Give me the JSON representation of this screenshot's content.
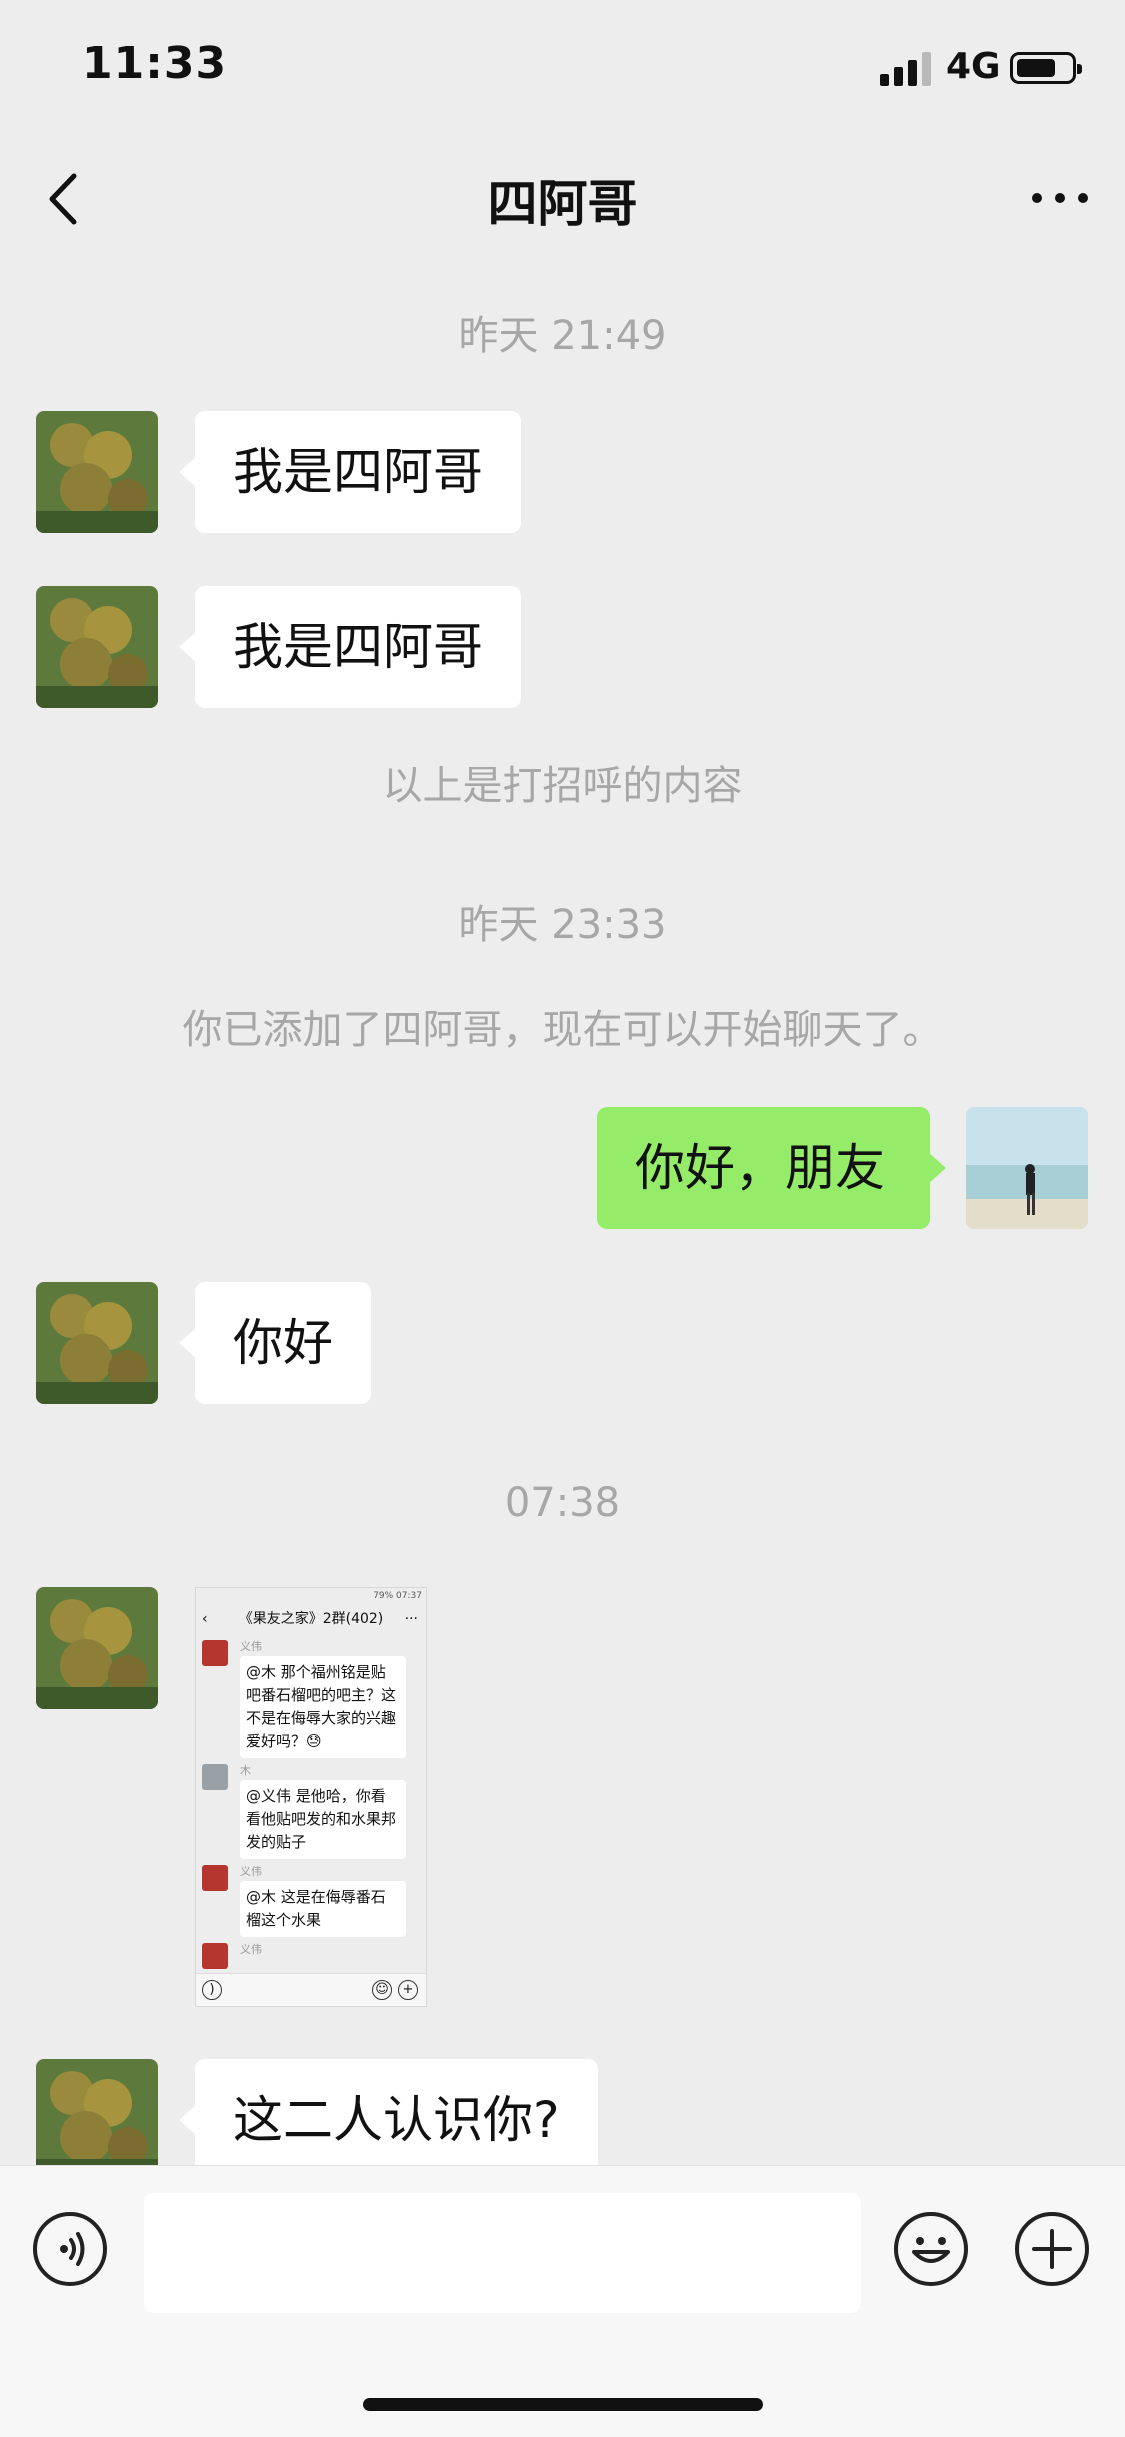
{
  "status_bar": {
    "time": "11:33",
    "network": "4G"
  },
  "header": {
    "title": "四阿哥"
  },
  "messages": {
    "ts1": "昨天 21:49",
    "m1": "我是四阿哥",
    "m2": "我是四阿哥",
    "note1": "以上是打招呼的内容",
    "ts2": "昨天 23:33",
    "note2": "你已添加了四阿哥，现在可以开始聊天了。",
    "m3": "你好，朋友",
    "m4": "你好",
    "ts3": "07:38",
    "m6": "这二人认识你?"
  },
  "shared_screenshot": {
    "status": "79% 07:37",
    "title": "《果友之家》2群(402)",
    "items": [
      {
        "name": "义伟",
        "text": "@木  那个福州铭是贴吧番石榴吧的吧主？这不是在侮辱大家的兴趣爱好吗？😓"
      },
      {
        "name": "木",
        "text": "@义伟  是他哈，你看看他贴吧发的和水果邦发的贴子"
      },
      {
        "name": "义伟",
        "text": "@木  这是在侮辱番石榴这个水果"
      },
      {
        "name": "义伟",
        "text": ""
      }
    ]
  },
  "icons": {
    "back": "chevron-left-icon",
    "more": "ellipsis-icon",
    "voice": "voice-icon",
    "emoji": "smiley-icon",
    "plus": "plus-icon"
  },
  "colors": {
    "background": "#ededed",
    "my_bubble": "#95ec69",
    "their_bubble": "#ffffff",
    "system_text": "#a7a7a7"
  }
}
